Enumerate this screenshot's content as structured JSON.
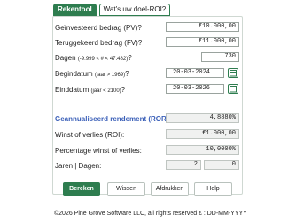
{
  "tabs": [
    {
      "label": "Rekentool",
      "active": true
    },
    {
      "label": "Wat's uw doel-ROI?",
      "active": false
    }
  ],
  "fields": {
    "invested": {
      "label": "Geïnvesteerd bedrag (PV)?",
      "value": "€10.000,00"
    },
    "returned": {
      "label": "Teruggekeerd bedrag (FV)?",
      "value": "€11.000,00"
    },
    "days": {
      "label_main": "Dagen",
      "label_hint": "(-9.999 < # < 47.482)",
      "label_suffix": "?",
      "value": "730"
    },
    "start_date": {
      "label_main": "Begindatum",
      "label_hint": "(jaar > 1969)",
      "label_suffix": "?",
      "value": "20-03-2024"
    },
    "end_date": {
      "label_main": "Einddatum",
      "label_hint": "(jaar < 2100)",
      "label_suffix": "?",
      "value": "20-03-2026"
    }
  },
  "results": {
    "annualized": {
      "label": "Geannualiseerd rendement (ROR):",
      "value": "4,8880%"
    },
    "gain": {
      "label": "Winst of verlies (ROI):",
      "value": "€1.000,00"
    },
    "percentage": {
      "label": "Percentage winst of verlies:",
      "value": "10,0000%"
    },
    "years_days": {
      "label": "Jaren | Dagen:",
      "years": "2",
      "days": "0"
    }
  },
  "buttons": {
    "calculate": "Bereken",
    "clear": "Wissen",
    "print": "Afdrukken",
    "help": "Help"
  },
  "footer": {
    "copyright": "©2026 Pine Grove Software LLC, all rights reserved",
    "format": "€ : DD-MM-YYYY"
  },
  "colors": {
    "brand_green": "#2e7d4f",
    "accent_blue": "#3a5fb8"
  },
  "icons": {
    "calendar": "calendar-icon"
  }
}
